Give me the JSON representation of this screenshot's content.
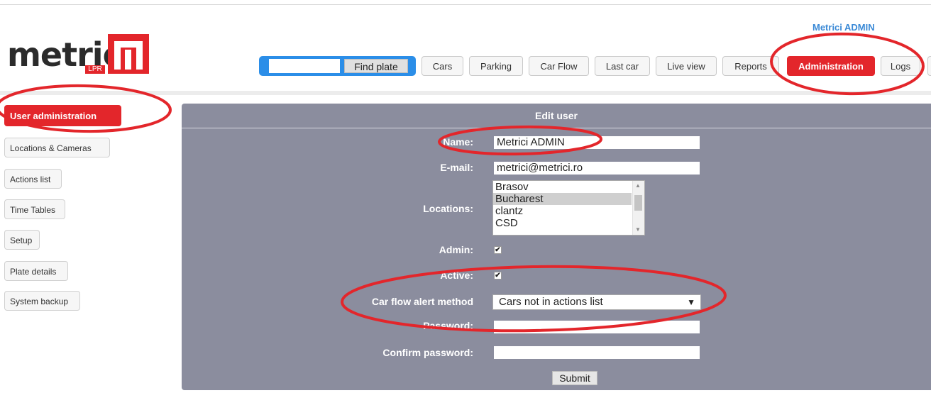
{
  "header": {
    "logo_text": "metricí",
    "logo_sub": "LPR",
    "user_name": "Metrici ADMIN"
  },
  "nav": {
    "search": {
      "value": "",
      "placeholder": ""
    },
    "find_label": "Find plate",
    "items": [
      {
        "label": "Cars",
        "active": false
      },
      {
        "label": "Parking",
        "active": false
      },
      {
        "label": "Car Flow",
        "active": false
      },
      {
        "label": "Last car",
        "active": false
      },
      {
        "label": "Live view",
        "active": false
      },
      {
        "label": "Reports",
        "active": false
      },
      {
        "label": "Administration",
        "active": true
      },
      {
        "label": "Logs",
        "active": false
      }
    ]
  },
  "sidebar": {
    "items": [
      {
        "label": "User administration",
        "active": true
      },
      {
        "label": "Locations & Cameras",
        "active": false
      },
      {
        "label": "Actions list",
        "active": false
      },
      {
        "label": "Time Tables",
        "active": false
      },
      {
        "label": "Setup",
        "active": false
      },
      {
        "label": "Plate details",
        "active": false
      },
      {
        "label": "System backup",
        "active": false
      }
    ]
  },
  "form": {
    "title": "Edit user",
    "name_label": "Name:",
    "name_value": "Metrici ADMIN",
    "email_label": "E-mail:",
    "email_value": "metrici@metrici.ro",
    "locations_label": "Locations:",
    "locations": [
      {
        "label": "Brasov",
        "selected": false
      },
      {
        "label": "Bucharest",
        "selected": true
      },
      {
        "label": "clantz",
        "selected": false
      },
      {
        "label": "CSD",
        "selected": false
      }
    ],
    "admin_label": "Admin:",
    "admin_checked": true,
    "active_label": "Active:",
    "active_checked": true,
    "alert_label": "Car flow alert method",
    "alert_value": "Cars not in actions list",
    "password_label": "Password:",
    "password_value": "",
    "confirm_label": "Confirm password:",
    "confirm_value": "",
    "submit_label": "Submit"
  },
  "colors": {
    "brand_red": "#e3262b",
    "panel_bg": "#8b8d9e",
    "search_blue": "#2b8ee8",
    "username_blue": "#3a89d6"
  }
}
